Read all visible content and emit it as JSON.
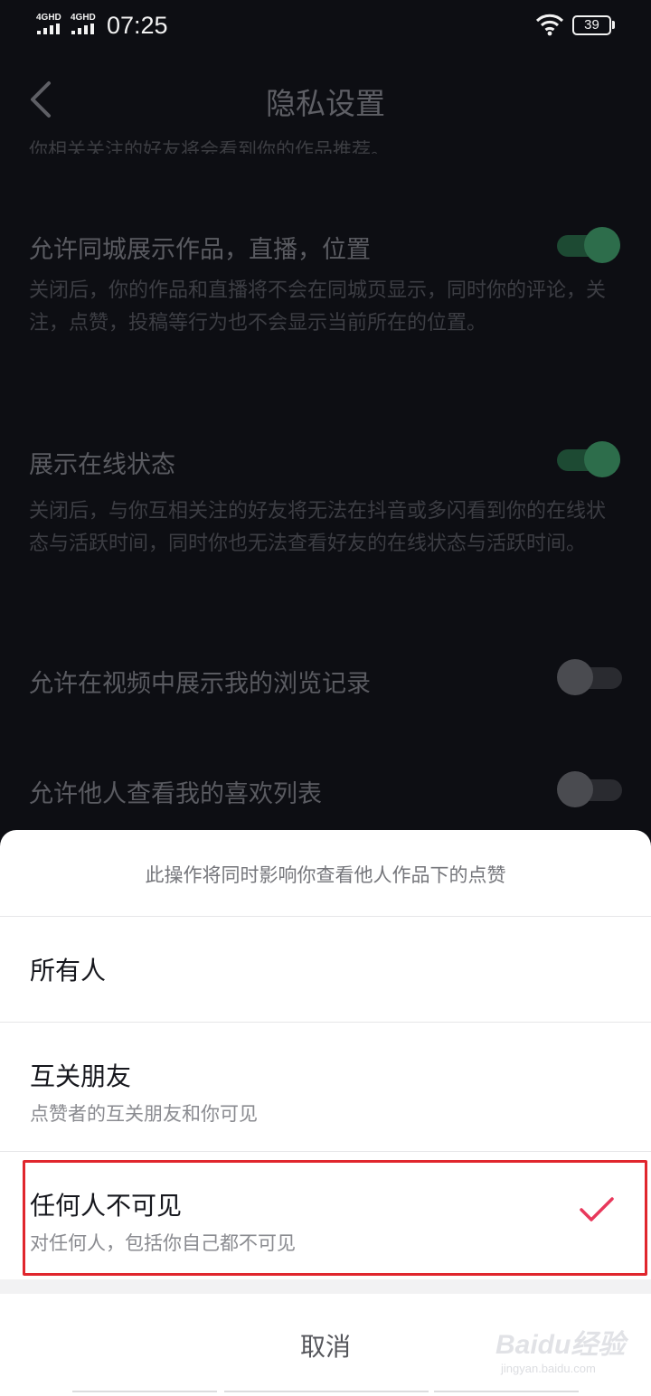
{
  "status_bar": {
    "network_1": "4GHD",
    "network_2": "4GHD",
    "time": "07:25",
    "battery": "39"
  },
  "header": {
    "title": "隐私设置",
    "back_icon": "chevron-left-icon",
    "clipped_text": "你相关关注的好友将会看到你的作品推荐。"
  },
  "settings": [
    {
      "title": "允许同城展示作品，直播，位置",
      "description": "关闭后，你的作品和直播将不会在同城页显示，同时你的评论，关注，点赞，投稿等行为也不会显示当前所在的位置。",
      "enabled": true
    },
    {
      "title": "展示在线状态",
      "description": "关闭后，与你互相关注的好友将无法在抖音或多闪看到你的在线状态与活跃时间，同时你也无法查看好友的在线状态与活跃时间。",
      "enabled": true
    },
    {
      "title": "允许在视频中展示我的浏览记录",
      "enabled": false
    },
    {
      "title": "允许他人查看我的喜欢列表",
      "enabled": false
    }
  ],
  "sheet": {
    "hint": "此操作将同时影响你查看他人作品下的点赞",
    "options": [
      {
        "label": "所有人",
        "description": "",
        "selected": false
      },
      {
        "label": "互关朋友",
        "description": "点赞者的互关朋友和你可见",
        "selected": false
      },
      {
        "label": "任何人不可见",
        "description": "对任何人，包括你自己都不可见",
        "selected": true
      }
    ],
    "cancel": "取消"
  },
  "colors": {
    "background": "#0d0e13",
    "toggle_on": "#2d6d4b",
    "check": "#e8385b",
    "highlight": "#e0262d"
  },
  "watermark": {
    "main": "Baidu经验",
    "sub": "jingyan.baidu.com"
  }
}
